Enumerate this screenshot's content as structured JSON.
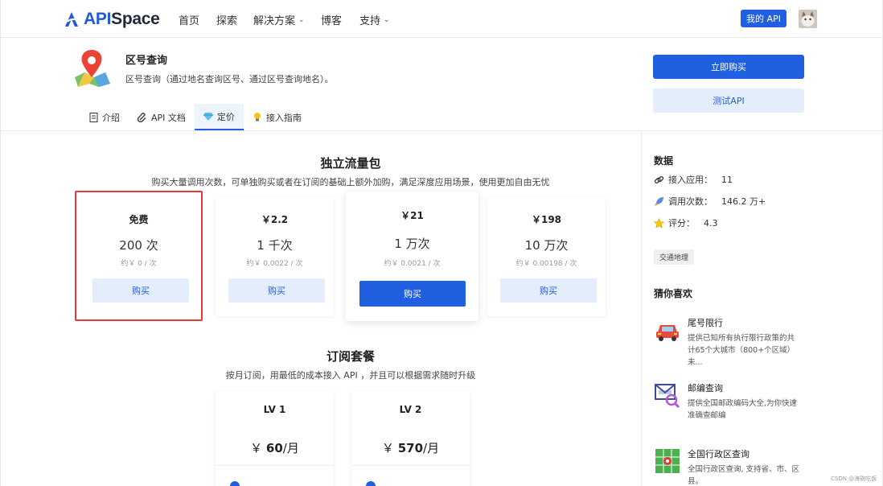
{
  "nav": {
    "logo_api": "API",
    "logo_space": "Space",
    "links": [
      "首页",
      "探索",
      "解决方案",
      "博客",
      "支持"
    ],
    "my_api": "我的 API"
  },
  "product": {
    "title": "区号查询",
    "description": "区号查询（通过地名查询区号、通过区号查询地名）。",
    "buy_now": "立即购买",
    "test_api": "测试API"
  },
  "tabs": [
    {
      "label": "介绍",
      "icon": "document-icon"
    },
    {
      "label": "API 文档",
      "icon": "paperclip-icon"
    },
    {
      "label": "定价",
      "icon": "diamond-icon",
      "active": true
    },
    {
      "label": "接入指南",
      "icon": "lightbulb-icon"
    }
  ],
  "traffic": {
    "title": "独立流量包",
    "subtitle": "购买大量调用次数，可单独购买或者在订阅的基础上额外加购，满足深度应用场景，使用更加自由无忧",
    "plans": [
      {
        "name": "免费",
        "qty": "200 次",
        "unit": "约￥ 0 / 次",
        "button": "购买"
      },
      {
        "name": "￥2.2",
        "qty": "1 千次",
        "unit": "约￥ 0.0022 / 次",
        "button": "购买"
      },
      {
        "name": "￥21",
        "qty": "1 万次",
        "unit": "约￥ 0.0021 / 次",
        "button": "购买"
      },
      {
        "name": "￥198",
        "qty": "10 万次",
        "unit": "约￥ 0.00198 / 次",
        "button": "购买"
      }
    ]
  },
  "subscription": {
    "title": "订阅套餐",
    "subtitle": "按月订阅，用最低的成本接入 API ，并且可以根据需求随时升级",
    "plans": [
      {
        "name": "LV 1",
        "currency": "￥",
        "amount": "60",
        "period": "/月"
      },
      {
        "name": "LV 2",
        "currency": "￥",
        "amount": "570",
        "period": "/月"
      }
    ]
  },
  "sidebar": {
    "data_title": "数据",
    "stats": [
      {
        "label": "接入应用：",
        "value": "11",
        "icon": "link-icon"
      },
      {
        "label": "调用次数：",
        "value": "146.2 万+",
        "icon": "rocket-icon"
      },
      {
        "label": "评分：",
        "value": "4.3",
        "icon": "star-icon"
      }
    ],
    "tag": "交通地理",
    "recommend_title": "猜你喜欢",
    "recommendations": [
      {
        "title": "尾号限行",
        "desc": "提供已知所有执行限行政策的共计65个大城市（800+个区域）未...",
        "icon": "car-icon"
      },
      {
        "title": "邮编查询",
        "desc": "提供全国邮政编码大全,为你快速准确查邮编",
        "icon": "mail-search-icon"
      },
      {
        "title": "全国行政区查询",
        "desc": "全国行政区查询, 支持省、市、区县。",
        "icon": "map-grid-icon"
      }
    ]
  },
  "watermark": "CSDN @海碗吃饭",
  "colors": {
    "primary": "#1f5fe0",
    "primary_light": "#e4edfc",
    "highlight": "#e53935"
  }
}
